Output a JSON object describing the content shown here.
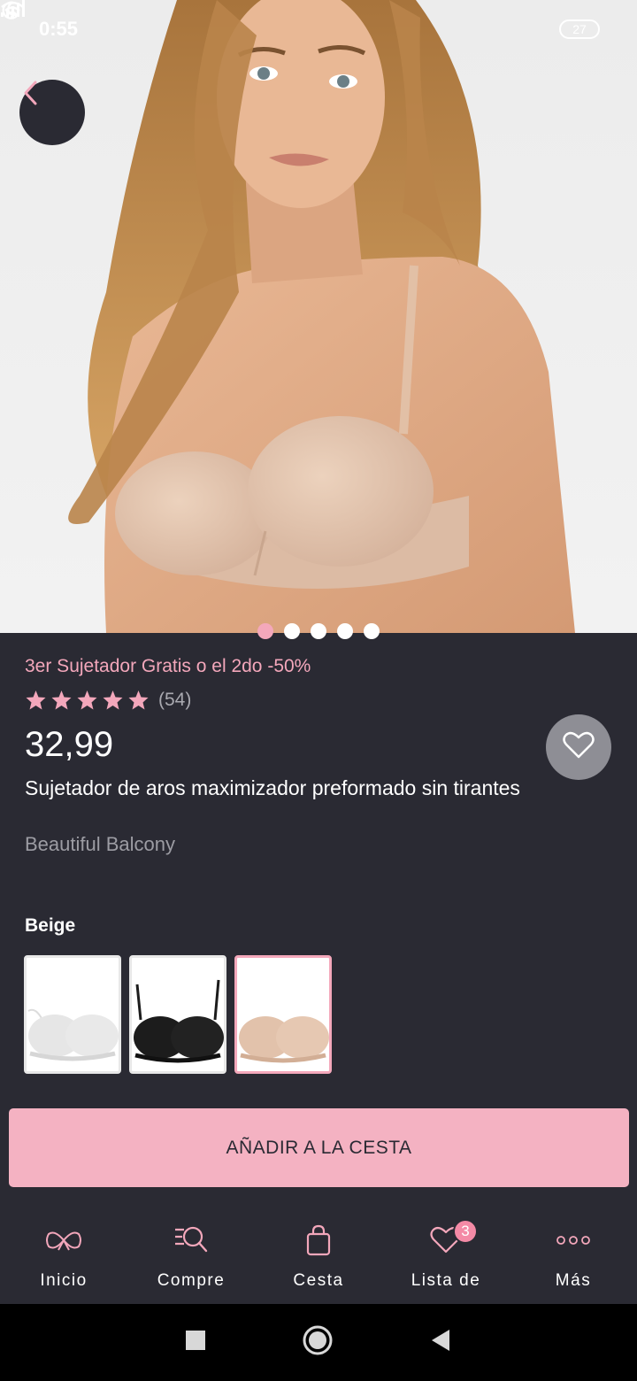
{
  "status_bar": {
    "time": "0:55",
    "battery": "27",
    "icons": [
      "moon-icon",
      "signal-icon",
      "wifi-icon",
      "battery-icon"
    ]
  },
  "hero": {
    "image_count": 5,
    "active_index": 0
  },
  "product": {
    "promo": "3er Sujetador Gratis o el 2do -50%",
    "rating_stars": 5,
    "rating_count": "(54)",
    "price": "32,99",
    "title": "Sujetador de aros maximizador preformado sin tirantes",
    "collection": "Beautiful Balcony"
  },
  "colors": {
    "label": "Beige",
    "swatches": [
      {
        "name": "white",
        "hex": "#f2f2f2",
        "selected": false
      },
      {
        "name": "black",
        "hex": "#1c1c1c",
        "selected": false
      },
      {
        "name": "beige",
        "hex": "#e2c2ab",
        "selected": true
      }
    ]
  },
  "actions": {
    "add_to_cart": "AÑADIR A LA CESTA"
  },
  "bottom_nav": {
    "items": [
      {
        "label": "Inicio",
        "icon": "bow-icon"
      },
      {
        "label": "Compre",
        "icon": "search-list-icon"
      },
      {
        "label": "Cesta",
        "icon": "bag-icon"
      },
      {
        "label": "Lista de",
        "icon": "heart-icon",
        "badge": "3"
      },
      {
        "label": "Más",
        "icon": "more-icon"
      }
    ]
  },
  "theme": {
    "background": "#2a2a33",
    "accent_pink": "#f4b2c2",
    "promo_pink": "#f3a7bb"
  }
}
